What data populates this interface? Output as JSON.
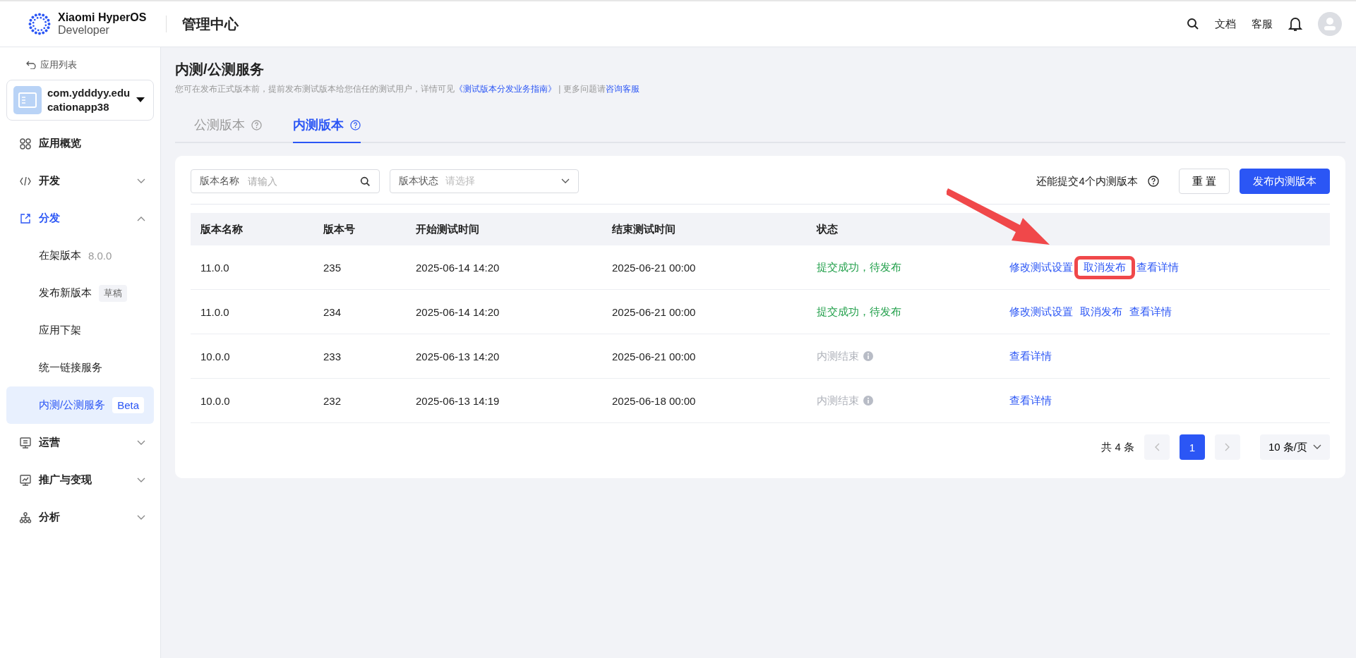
{
  "header": {
    "brand_line1": "Xiaomi HyperOS",
    "brand_line2": "Developer",
    "title": "管理中心",
    "links": [
      "文档",
      "客服"
    ]
  },
  "sidebar": {
    "back_link": "应用列表",
    "app": {
      "name": "com.ydddyy.educationapp38"
    },
    "nav": [
      {
        "label": "应用概览",
        "kind": "overview",
        "selected": false
      },
      {
        "label": "开发",
        "kind": "dev",
        "selected": false,
        "expanded": false
      },
      {
        "label": "分发",
        "kind": "dist",
        "selected": true,
        "expanded": true,
        "children": [
          {
            "label": "在架版本",
            "meta": "8.0.0",
            "selected": false
          },
          {
            "label": "发布新版本",
            "badge": "草稿",
            "selected": false
          },
          {
            "label": "应用下架",
            "selected": false
          },
          {
            "label": "统一链接服务",
            "selected": false
          },
          {
            "label": "内测/公测服务",
            "badge": "Beta",
            "selected": true
          }
        ]
      },
      {
        "label": "运营",
        "kind": "ops",
        "selected": false,
        "expanded": false
      },
      {
        "label": "推广与变现",
        "kind": "promo",
        "selected": false,
        "expanded": false
      },
      {
        "label": "分析",
        "kind": "analysis",
        "selected": false,
        "expanded": false
      }
    ]
  },
  "page": {
    "title": "内测/公测服务",
    "intro": "您可在发布正式版本前，提前发布测试版本给您信任的测试用户，详情可见",
    "guide_link": "《测试版本分发业务指南》",
    "separator": "|",
    "more": "更多问题请",
    "support_link": "咨询客服",
    "tabs": [
      {
        "label": "公测版本",
        "selected": false
      },
      {
        "label": "内测版本",
        "selected": true
      }
    ]
  },
  "filters": {
    "name_label": "版本名称",
    "name_placeholder": "请输入",
    "status_label": "版本状态",
    "status_placeholder": "请选择",
    "quota": "还能提交4个内测版本",
    "reset": "重 置",
    "publish": "发布内测版本"
  },
  "table": {
    "columns": [
      "版本名称",
      "版本号",
      "开始测试时间",
      "结束测试时间",
      "状态"
    ],
    "rows": [
      {
        "name": "11.0.0",
        "build": "235",
        "start": "2025-06-14 14:20",
        "end": "2025-06-21 00:00",
        "status": "提交成功，待发布",
        "kind": "pending",
        "actions": [
          {
            "label": "修改测试设置",
            "highlighted": false
          },
          {
            "label": "取消发布",
            "highlighted": true
          },
          {
            "label": "查看详情",
            "highlighted": false
          }
        ]
      },
      {
        "name": "11.0.0",
        "build": "234",
        "start": "2025-06-14 14:20",
        "end": "2025-06-21 00:00",
        "status": "提交成功，待发布",
        "kind": "pending",
        "actions": [
          {
            "label": "修改测试设置",
            "highlighted": false
          },
          {
            "label": "取消发布",
            "highlighted": false
          },
          {
            "label": "查看详情",
            "highlighted": false
          }
        ]
      },
      {
        "name": "10.0.0",
        "build": "233",
        "start": "2025-06-13 14:20",
        "end": "2025-06-21 00:00",
        "status": "内测结束",
        "kind": "ended",
        "actions": [
          {
            "label": "查看详情",
            "highlighted": false
          }
        ]
      },
      {
        "name": "10.0.0",
        "build": "232",
        "start": "2025-06-13 14:19",
        "end": "2025-06-18 00:00",
        "status": "内测结束",
        "kind": "ended",
        "actions": [
          {
            "label": "查看详情",
            "highlighted": false
          }
        ]
      }
    ]
  },
  "pagination": {
    "total": "共 4 条",
    "pages": [
      {
        "label": "1",
        "selected": true
      }
    ],
    "page_size": "10 条/页"
  }
}
